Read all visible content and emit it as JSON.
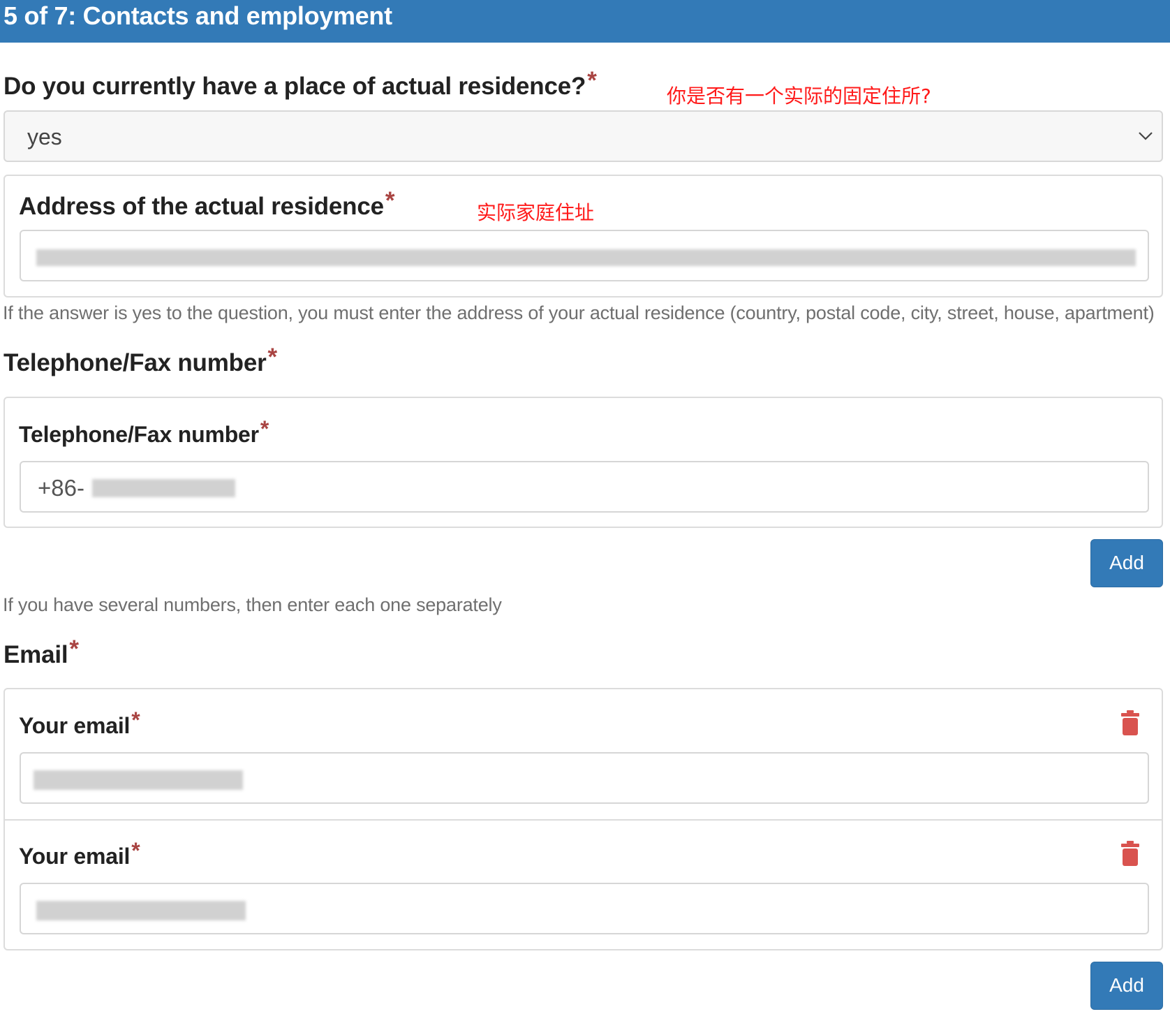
{
  "header": {
    "title": "5 of 7: Contacts and employment"
  },
  "residence_question": {
    "label": "Do you currently have a place of actual residence?",
    "required_mark": "*",
    "annotation": "你是否有一个实际的固定住所?",
    "selected_value": "yes"
  },
  "address": {
    "label": "Address of the actual residence",
    "required_mark": "*",
    "annotation": "实际家庭住址",
    "help": "If the answer is yes to the question, you must enter the address of your actual residence (country, postal code, city, street, house, apartment)"
  },
  "telephone": {
    "section_label": "Telephone/Fax number",
    "required_mark": "*",
    "field_label": "Telephone/Fax number",
    "value_prefix": "+86-",
    "add_label": "Add",
    "help": "If you have several numbers, then enter each one separately"
  },
  "email": {
    "section_label": "Email",
    "required_mark": "*",
    "entries": [
      {
        "label": "Your email",
        "required_mark": "*"
      },
      {
        "label": "Your email",
        "required_mark": "*"
      }
    ],
    "add_label": "Add"
  },
  "colors": {
    "primary": "#337ab7",
    "required": "#a94442",
    "annotation": "#ff1a1a",
    "delete": "#d9534f"
  },
  "icons": {
    "select": "chevron-down-icon",
    "delete": "trash-icon"
  }
}
